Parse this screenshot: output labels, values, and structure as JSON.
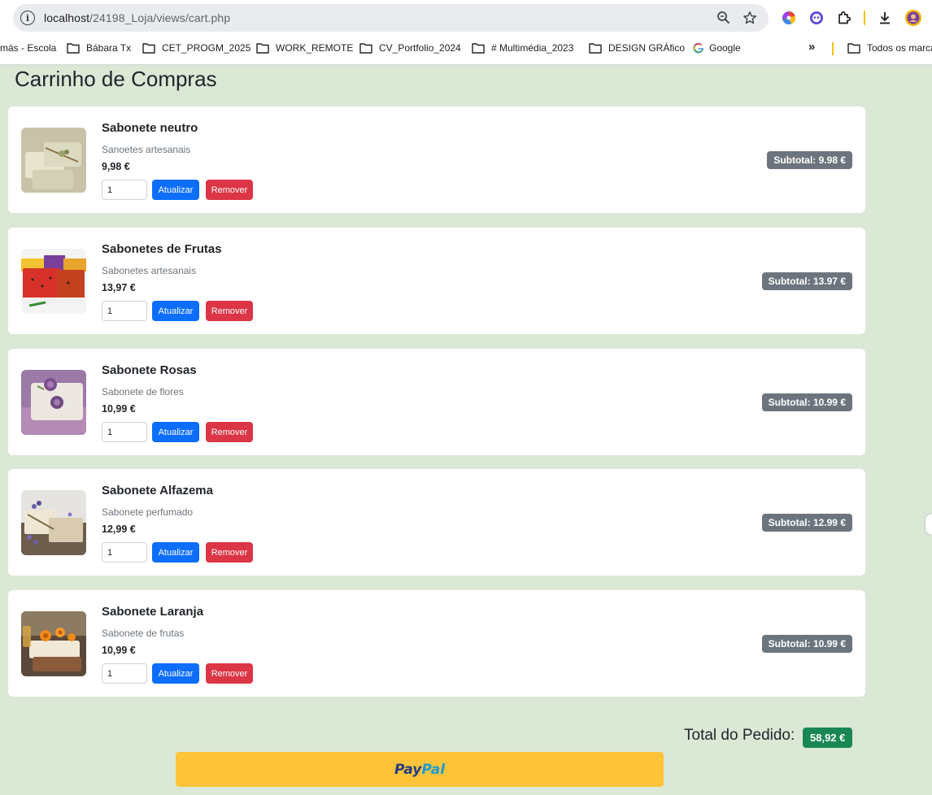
{
  "browser": {
    "url_host": "localhost",
    "url_path": "/24198_Loja/views/cart.php",
    "bookmarks": [
      "más - Escola",
      "Bábara Tx",
      "CET_PROGM_2025",
      "WORK_REMOTE",
      "CV_Portfolio_2024",
      "# Multimédia_2023",
      "DESIGN GRÁfico",
      "Google"
    ],
    "more_bookmarks": "»",
    "all_bookmarks": "Todos os marca"
  },
  "page": {
    "title": "Carrinho de Compras",
    "update_label": "Atualizar",
    "remove_label": "Remover"
  },
  "cart": {
    "items": [
      {
        "name": "Sabonete neutro",
        "description": "Sanoetes artesanais",
        "price": "9,98 €",
        "quantity": "1",
        "subtotal": "Subtotal: 9.98 €"
      },
      {
        "name": "Sabonetes de Frutas",
        "description": "Sabonetes artesanais",
        "price": "13,97 €",
        "quantity": "1",
        "subtotal": "Subtotal: 13.97 €"
      },
      {
        "name": "Sabonete Rosas",
        "description": "Sabonete de flores",
        "price": "10,99 €",
        "quantity": "1",
        "subtotal": "Subtotal: 10.99 €"
      },
      {
        "name": "Sabonete Alfazema",
        "description": "Sabonete perfumado",
        "price": "12,99 €",
        "quantity": "1",
        "subtotal": "Subtotal: 12.99 €"
      },
      {
        "name": "Sabonete Laranja",
        "description": "Sabonete de frutas",
        "price": "10,99 €",
        "quantity": "1",
        "subtotal": "Subtotal: 10.99 €"
      }
    ],
    "total_label": "Total do Pedido:",
    "total_value": "58,92 €"
  },
  "paypal": {
    "part1": "Pay",
    "part2": "Pal"
  },
  "colors": {
    "background": "#dbe8d6",
    "primary": "#0d6efd",
    "danger": "#dc3545",
    "secondary": "#6c757d",
    "success": "#198754",
    "paypal_yellow": "#ffc439"
  }
}
